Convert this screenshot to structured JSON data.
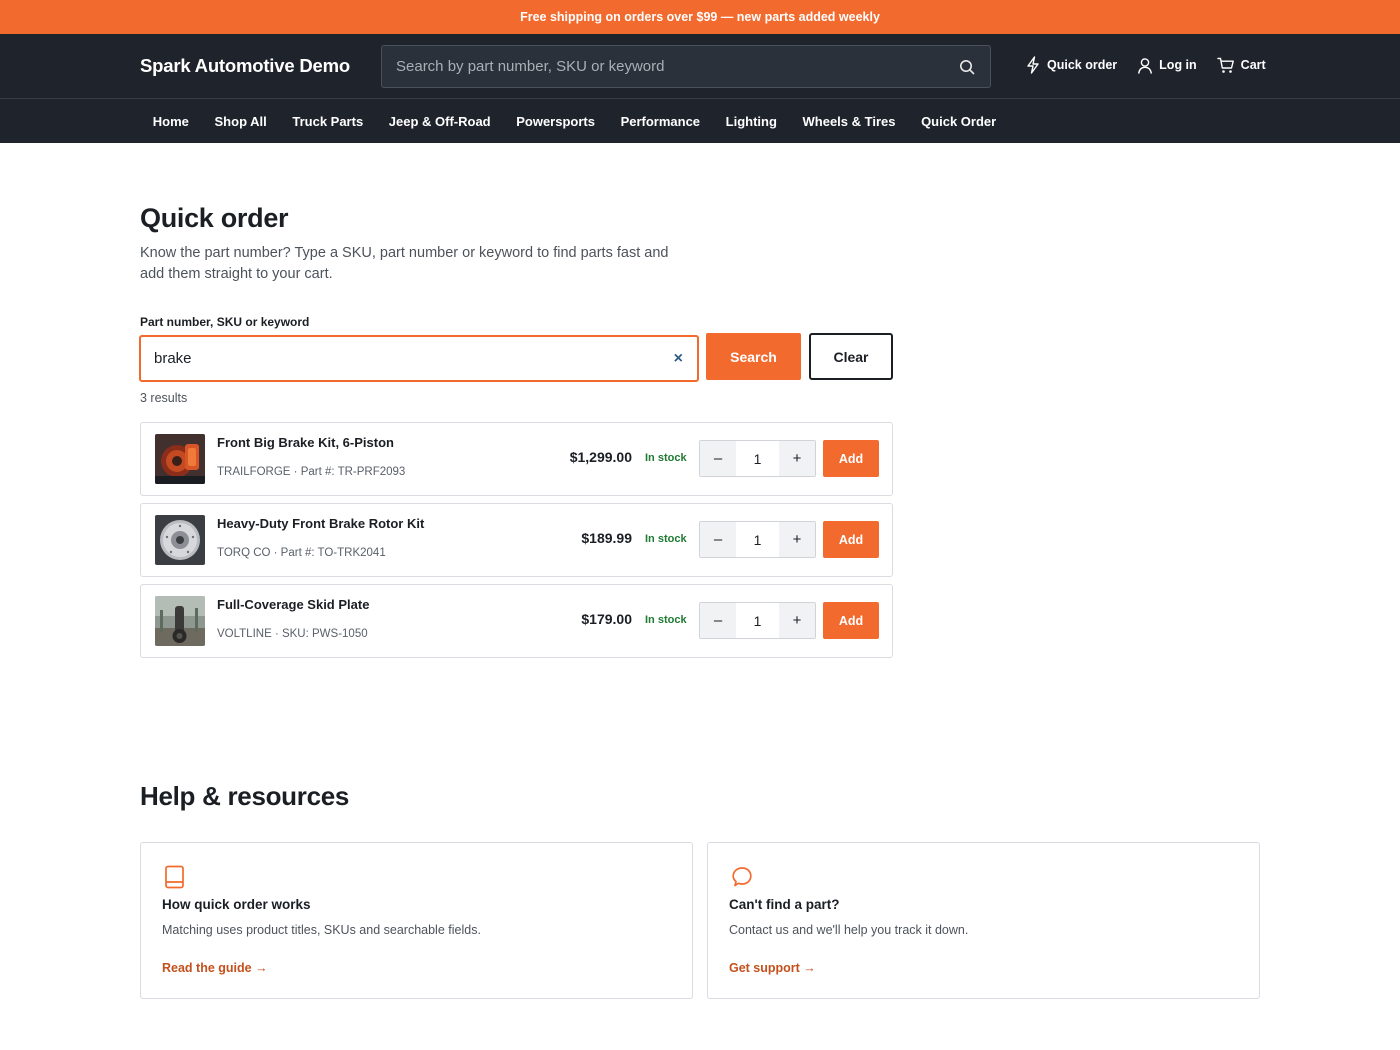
{
  "promo": {
    "text": "Free shipping on orders over $99 — new parts added weekly"
  },
  "header": {
    "logo": "Spark Automotive Demo",
    "search_placeholder": "Search by part number, SKU or keyword",
    "actions": {
      "quick_order": "Quick order",
      "login": "Log in",
      "cart": "Cart"
    }
  },
  "nav": {
    "items": [
      "Home",
      "Shop All",
      "Truck Parts",
      "Jeep & Off-Road",
      "Powersports",
      "Performance",
      "Lighting",
      "Wheels & Tires",
      "Quick Order"
    ]
  },
  "quick_order": {
    "title": "Quick order",
    "description": "Know the part number? Type a SKU, part number or keyword to find parts fast and add them straight to your cart.",
    "field_label": "Part number, SKU or keyword",
    "query": "brake",
    "clear_icon": "×",
    "search_button": "Search",
    "clear_button": "Clear",
    "results_count": "3 results",
    "results": [
      {
        "name": "Front Big Brake Kit, 6-Piston",
        "meta": "TRAILFORGE · Part #: TR-PRF2093",
        "price": "$1,299.00",
        "stock": "In stock",
        "qty": "1",
        "add": "Add"
      },
      {
        "name": "Heavy-Duty Front Brake Rotor Kit",
        "meta": "TORQ CO · Part #: TO-TRK2041",
        "price": "$189.99",
        "stock": "In stock",
        "qty": "1",
        "add": "Add"
      },
      {
        "name": "Full-Coverage Skid Plate",
        "meta": "VOLTLINE · SKU: PWS-1050",
        "price": "$179.00",
        "stock": "In stock",
        "qty": "1",
        "add": "Add"
      }
    ],
    "qty_minus": "–",
    "qty_plus": "+"
  },
  "help": {
    "title": "Help & resources",
    "cards": [
      {
        "icon": "book-icon",
        "title": "How quick order works",
        "text": "Matching uses product titles, SKUs and searchable fields.",
        "link": "Read the guide →"
      },
      {
        "icon": "chat-bubble-icon",
        "title": "Can't find a part?",
        "text": "Contact us and we'll help you track it down.",
        "link": "Get support →"
      }
    ]
  },
  "colors": {
    "accent": "#f26a2e",
    "header_bg": "#1f242c",
    "in_stock": "#1f7a33",
    "link": "#c4501c"
  }
}
